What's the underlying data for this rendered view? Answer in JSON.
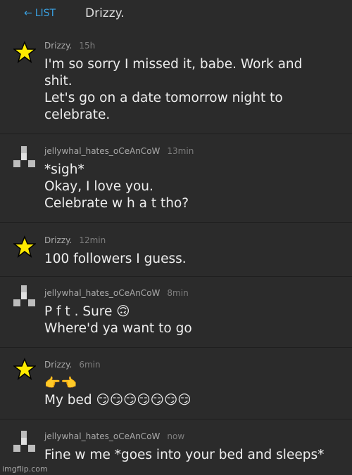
{
  "header": {
    "back_label": "LIST",
    "title": "Drizzy."
  },
  "messages": [
    {
      "author": "Drizzy.",
      "time": "15h",
      "avatar": "star-icon",
      "lines": [
        "I'm so sorry I missed it, babe. Work and",
        "shit.",
        "Let's go on a date tomorrow night to",
        "celebrate."
      ]
    },
    {
      "author": "jellywhal_hates_oCeAnCoW",
      "time": "13min",
      "avatar": "pixel-block-icon",
      "lines": [
        "*sigh*",
        "Okay, I love you.",
        "Celebrate w h a t tho?"
      ]
    },
    {
      "author": "Drizzy.",
      "time": "12min",
      "avatar": "star-icon",
      "lines": [
        "100 followers I guess."
      ]
    },
    {
      "author": "jellywhal_hates_oCeAnCoW",
      "time": "8min",
      "avatar": "pixel-block-icon",
      "lines": [
        "P f t . Sure 🙃",
        "Where'd ya want to go"
      ]
    },
    {
      "author": "Drizzy.",
      "time": "6min",
      "avatar": "star-icon",
      "lines": [
        "👉👈",
        "My bed 😏😏😏😏😏😏😏"
      ]
    },
    {
      "author": "jellywhal_hates_oCeAnCoW",
      "time": "now",
      "avatar": "pixel-block-icon",
      "lines": [
        "Fine w me *goes into your bed and sleeps*"
      ]
    }
  ],
  "watermark": "imgflip.com",
  "colors": {
    "background": "#2b2b2b",
    "link": "#39a0e0",
    "star": "#ffeb00"
  }
}
